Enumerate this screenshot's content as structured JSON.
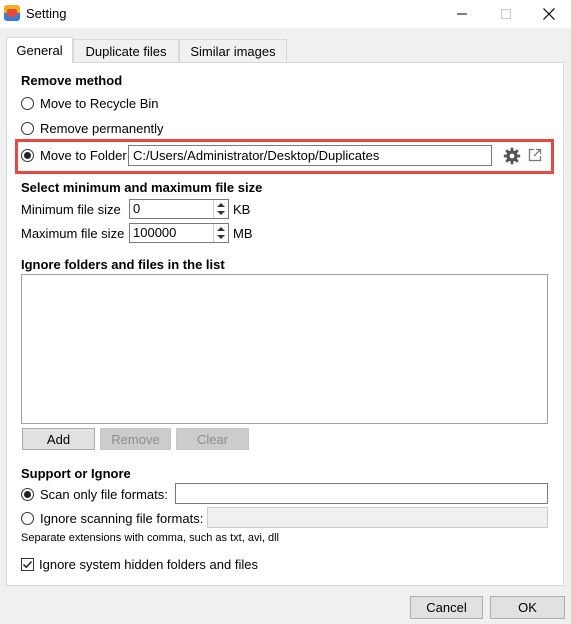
{
  "window": {
    "title": "Setting"
  },
  "tabs": [
    {
      "label": "General",
      "active": true
    },
    {
      "label": "Duplicate files",
      "active": false
    },
    {
      "label": "Similar images",
      "active": false
    }
  ],
  "remove_method": {
    "title": "Remove method",
    "options": [
      {
        "label": "Move to Recycle Bin",
        "checked": false
      },
      {
        "label": "Remove permanently",
        "checked": false
      },
      {
        "label": "Move to Folder",
        "checked": true
      }
    ],
    "folder_path": "C:/Users/Administrator/Desktop/Duplicates",
    "highlight_color": "#e8483f"
  },
  "file_size": {
    "title": "Select minimum and maximum file size",
    "min_label": "Minimum file size",
    "min_value": "0",
    "min_unit": "KB",
    "max_label": "Maximum file size",
    "max_value": "100000",
    "max_unit": "MB"
  },
  "ignore_list": {
    "title": "Ignore folders and files in the list",
    "add_label": "Add",
    "remove_label": "Remove",
    "clear_label": "Clear"
  },
  "support": {
    "title": "Support or Ignore",
    "scan_only_label": "Scan only file formats:",
    "scan_only_checked": true,
    "scan_only_value": "",
    "ignore_label": "Ignore scanning file formats:",
    "ignore_checked": false,
    "ignore_value": "",
    "note": "Separate extensions with comma, such as txt, avi, dll"
  },
  "hidden_option": {
    "label": "Ignore system hidden folders and files",
    "checked": true
  },
  "footer": {
    "cancel_label": "Cancel",
    "ok_label": "OK"
  }
}
